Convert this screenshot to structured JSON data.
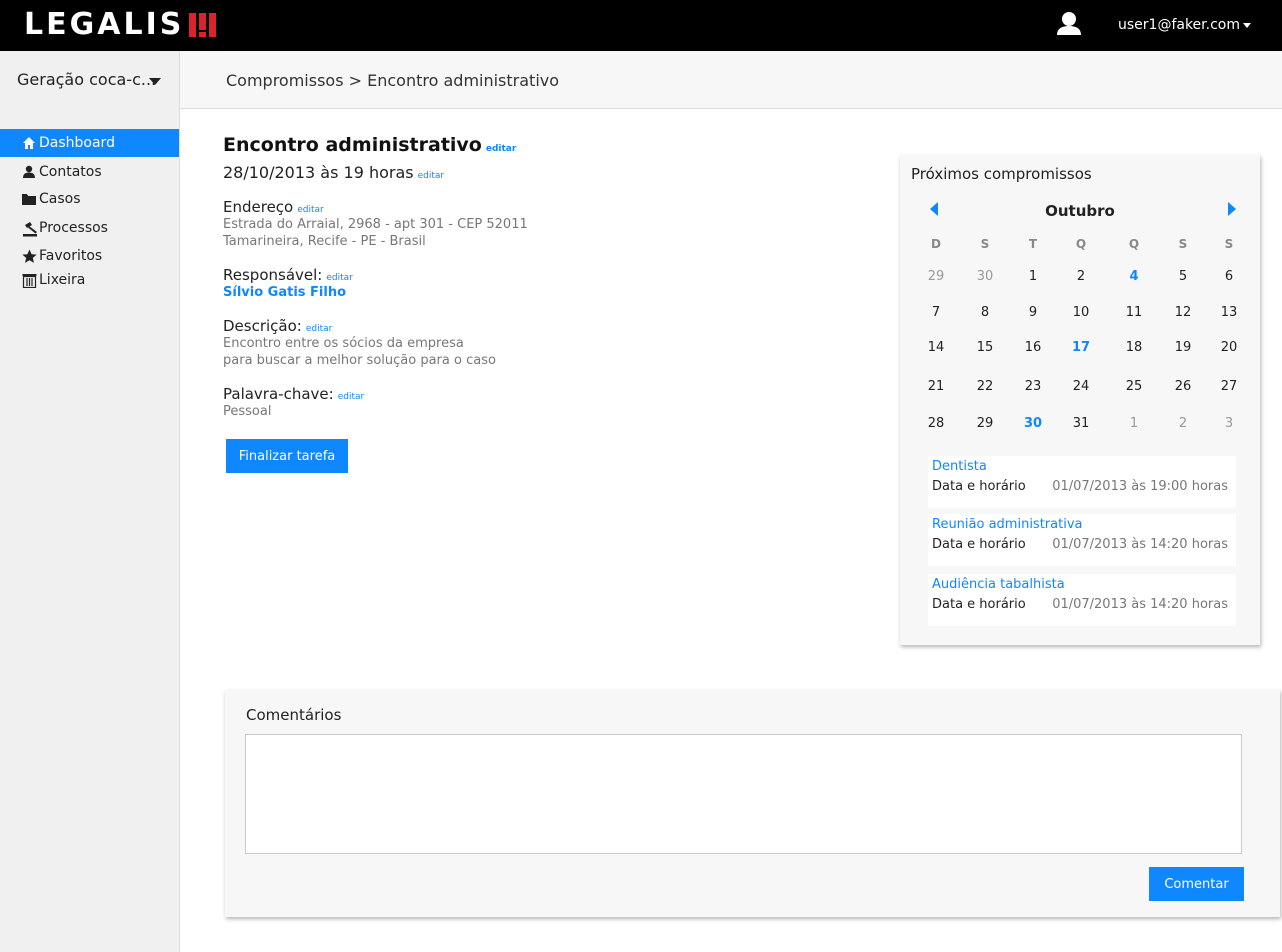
{
  "header": {
    "logo": "LEGALIS",
    "user_email": "user1@faker.com"
  },
  "sidebar": {
    "org": "Geração coca-c...",
    "items": [
      {
        "label": "Dashboard",
        "icon": "home-icon",
        "active": true
      },
      {
        "label": "Contatos",
        "icon": "person-icon",
        "active": false
      },
      {
        "label": "Casos",
        "icon": "folder-icon",
        "active": false
      },
      {
        "label": "Processos",
        "icon": "gavel-icon",
        "active": false
      },
      {
        "label": "Favoritos",
        "icon": "star-icon",
        "active": false
      },
      {
        "label": "Lixeira",
        "icon": "trash-icon",
        "active": false
      }
    ]
  },
  "breadcrumb": "Compromissos > Encontro administrativo",
  "detail": {
    "title": "Encontro administrativo",
    "edit": "editar",
    "datetime": "28/10/2013 às 19 horas",
    "address_label": "Endereço",
    "address_line1": "Estrada do Arraial, 2968 - apt 301 - CEP 52011",
    "address_line2": "Tamarineira, Recife - PE - Brasil",
    "responsible_label": "Responsável:",
    "responsible": "Sílvio Gatis Filho",
    "description_label": "Descrição:",
    "description_line1": "Encontro entre os sócios da empresa",
    "description_line2": "para buscar a melhor solução para o caso",
    "keyword_label": "Palavra-chave:",
    "keyword": "Pessoal",
    "finalize_button": "Finalizar tarefa"
  },
  "calendar": {
    "panel_title": "Próximos compromissos",
    "month": "Outubro",
    "weekdays": [
      "D",
      "S",
      "T",
      "Q",
      "Q",
      "S",
      "S"
    ],
    "weeks": [
      [
        {
          "d": "29",
          "m": true
        },
        {
          "d": "30",
          "m": true
        },
        {
          "d": "1"
        },
        {
          "d": "2"
        },
        {
          "d": "4",
          "h": true
        },
        {
          "d": "5"
        },
        {
          "d": "6"
        }
      ],
      [
        {
          "d": "7"
        },
        {
          "d": "8"
        },
        {
          "d": "9"
        },
        {
          "d": "10"
        },
        {
          "d": "11"
        },
        {
          "d": "12"
        },
        {
          "d": "13"
        }
      ],
      [
        {
          "d": "14"
        },
        {
          "d": "15"
        },
        {
          "d": "16"
        },
        {
          "d": "17",
          "h": true
        },
        {
          "d": "18"
        },
        {
          "d": "19"
        },
        {
          "d": "20"
        }
      ],
      [
        {
          "d": "21"
        },
        {
          "d": "22"
        },
        {
          "d": "23"
        },
        {
          "d": "24"
        },
        {
          "d": "25"
        },
        {
          "d": "26"
        },
        {
          "d": "27"
        }
      ],
      [
        {
          "d": "28"
        },
        {
          "d": "29"
        },
        {
          "d": "30",
          "h": true
        },
        {
          "d": "31"
        },
        {
          "d": "1",
          "m": true
        },
        {
          "d": "2",
          "m": true
        },
        {
          "d": "3",
          "m": true
        }
      ]
    ],
    "appointments": [
      {
        "title": "Dentista",
        "label": "Data e horário",
        "time": "01/07/2013 às 19:00 horas"
      },
      {
        "title": "Reunião administrativa",
        "label": "Data e horário",
        "time": "01/07/2013 às 14:20 horas"
      },
      {
        "title": "Audiência tabalhista",
        "label": "Data e horário",
        "time": "01/07/2013 às 14:20 horas"
      }
    ]
  },
  "comments": {
    "title": "Comentários",
    "placeholder": "",
    "submit_button": "Comentar"
  },
  "colors": {
    "accent": "#0f87ff",
    "topbar": "#000000",
    "logo_mark": "#d9232d"
  }
}
